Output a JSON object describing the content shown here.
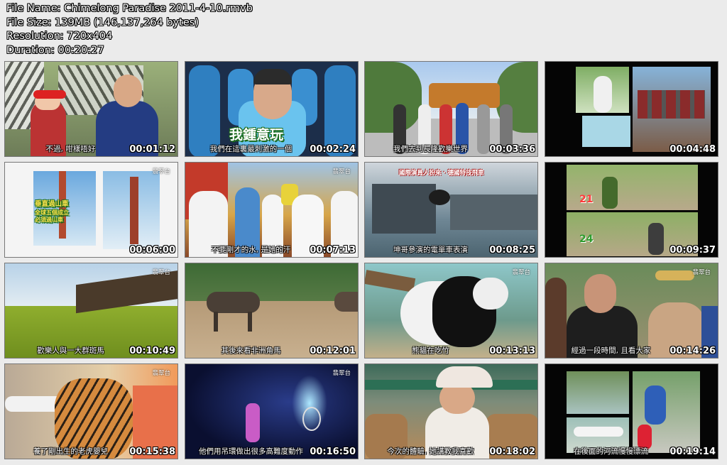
{
  "header": {
    "file_name": "File Name: Chimelong Paradise 2011-4-10.rmvb",
    "file_size": "File Size: 139MB (146,137,264 bytes)",
    "resolution": "Resolution: 720x404",
    "duration": "Duration: 00:20:27"
  },
  "thumbnails": [
    {
      "time": "00:01:12",
      "subtitle": "不過, 咁樣唔好"
    },
    {
      "time": "00:02:24",
      "subtitle": "我們在這裏最刺激的一個",
      "overlay": "我鍾意玩"
    },
    {
      "time": "00:03:36",
      "subtitle": "我們去到長隆歡樂世界"
    },
    {
      "time": "00:04:48",
      "subtitle": ""
    },
    {
      "time": "00:06:00",
      "subtitle": "",
      "poster_title": "垂直過山車",
      "poster_text": "全球五個成立\n必須過山車"
    },
    {
      "time": "00:07:13",
      "subtitle": "不要剛才的水, 是她的汗"
    },
    {
      "time": "00:08:25",
      "subtitle": "坤哥參演的電單車表演",
      "banner": "國際演員人扮來 · 德國特技飛車"
    },
    {
      "time": "00:09:37",
      "subtitle": "",
      "score1": "21",
      "score2": "24"
    },
    {
      "time": "00:10:49",
      "subtitle": "歡樂人與一大群斑馬"
    },
    {
      "time": "00:12:01",
      "subtitle": "其後來看非洲角馬"
    },
    {
      "time": "00:13:13",
      "subtitle": "熊貓在吃竹"
    },
    {
      "time": "00:14:26",
      "subtitle": "經過一段時間, 且看大家"
    },
    {
      "time": "00:15:38",
      "subtitle": "養了剛出生的老虎嬰兒"
    },
    {
      "time": "00:16:50",
      "subtitle": "他們用吊環做出很多高難度動作"
    },
    {
      "time": "00:18:02",
      "subtitle": "今次的體驗, 她講教我喜歡"
    },
    {
      "time": "00:19:14",
      "subtitle": "在後面的河流慢慢漂流"
    }
  ],
  "channel_logo": "翡翠台",
  "colors": {
    "background": "#ebebeb",
    "text": "#ffffff",
    "accent": "#1a6b1a"
  }
}
